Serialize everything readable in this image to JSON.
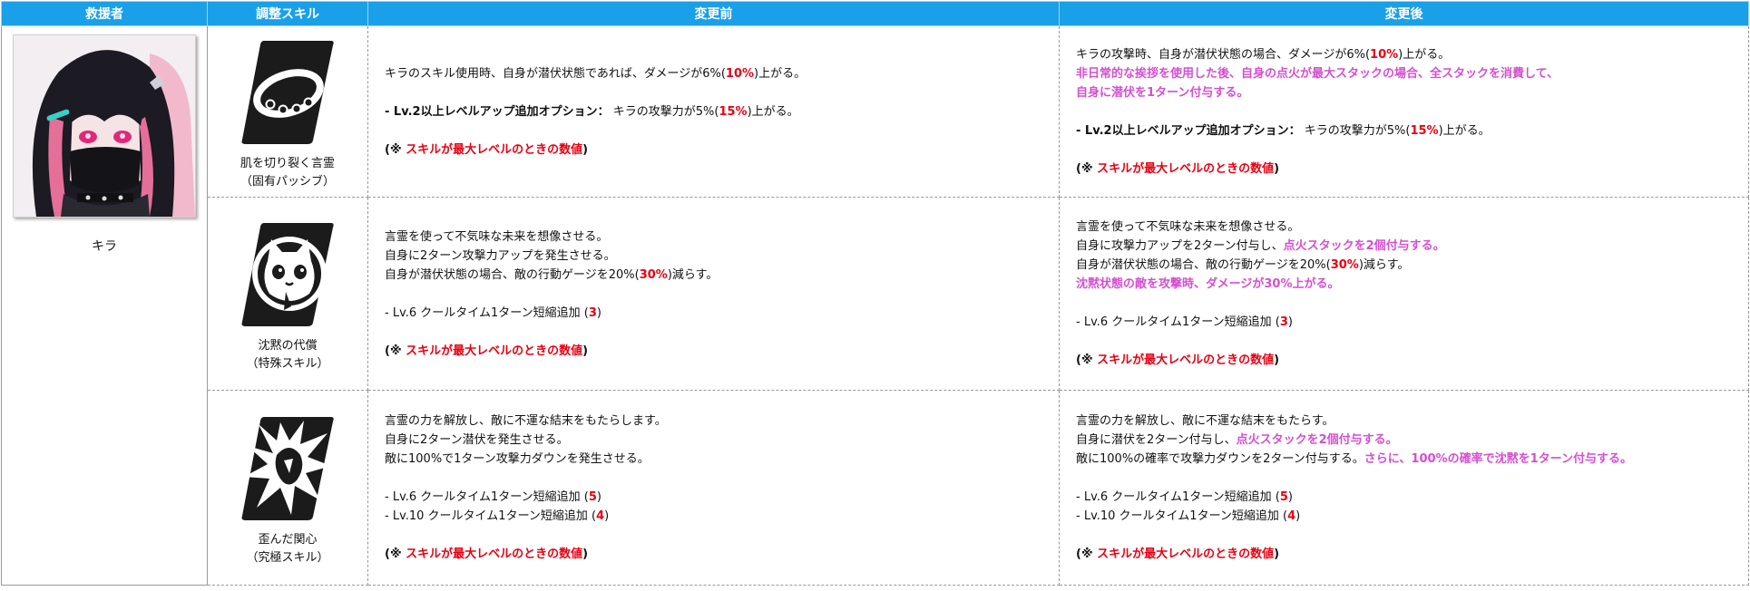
{
  "header": {
    "col_character": "救援者",
    "col_skill": "調整スキル",
    "col_before": "変更前",
    "col_after": "変更後"
  },
  "character": {
    "name": "キラ"
  },
  "rows": [
    {
      "skill_icon": "choker-icon",
      "skill_name": "肌を切り裂く言霊",
      "skill_type": "（固有パッシブ）",
      "before": {
        "l1a": "キラのスキル使用時、自身が潜伏状態であれば、ダメージが6%(",
        "l1r": "10%",
        "l1b": ")上がる。",
        "opt_label": "- Lv.2以上レベルアップ追加オプション：",
        "opt_text": " キラの攻撃力が5%(",
        "opt_red": "15%",
        "opt_end": ")上がる。",
        "note_open": "(※ ",
        "note_text": "スキルが最大レベルのときの数値",
        "note_close": ")"
      },
      "after": {
        "l1a": "キラの攻撃時、自身が潜伏状態の場合、ダメージが6%(",
        "l1r": "10%",
        "l1b": ")上がる。",
        "l2": "非日常的な挨拶を使用した後、自身の点火が最大スタックの場合、全スタックを消費して、",
        "l3": "自身に潜伏を1ターン付与する。",
        "opt_label": "- Lv.2以上レベルアップ追加オプション：",
        "opt_text": " キラの攻撃力が5%(",
        "opt_red": "15%",
        "opt_end": ")上がる。",
        "note_open": "(※ ",
        "note_text": "スキルが最大レベルのときの数値",
        "note_close": ")"
      }
    },
    {
      "skill_icon": "panda-cat-icon",
      "skill_name": "沈黙の代償",
      "skill_type": "（特殊スキル）",
      "before": {
        "l1": "言霊を使って不気味な未来を想像させる。",
        "l2": "自身に2ターン攻撃力アップを発生させる。",
        "l3a": "自身が潜伏状態の場合、敵の行動ゲージを20%(",
        "l3r": "30%",
        "l3b": ")減らす。",
        "cd1a": "- Lv.6 クールタイム1ターン短縮追加 (",
        "cd1r": "3",
        "cd1b": ")",
        "note_open": "(※ ",
        "note_text": "スキルが最大レベルのときの数値",
        "note_close": ")"
      },
      "after": {
        "l1": "言霊を使って不気味な未来を想像させる。",
        "l2a": "自身に攻撃力アップを2ターン付与し、",
        "l2p": "点火スタックを2個付与する。",
        "l3a": "自身が潜伏状態の場合、敵の行動ゲージを20%(",
        "l3r": "30%",
        "l3b": ")減らす。",
        "l4": "沈黙状態の敵を攻撃時、ダメージが30%上がる。",
        "cd1a": "- Lv.6 クールタイム1ターン短縮追加 (",
        "cd1r": "3",
        "cd1b": ")",
        "note_open": "(※ ",
        "note_text": "スキルが最大レベルのときの数値",
        "note_close": ")"
      }
    },
    {
      "skill_icon": "shatter-burst-icon",
      "skill_name": "歪んだ関心",
      "skill_type": "（究極スキル）",
      "before": {
        "l1": "言霊の力を解放し、敵に不運な結末をもたらします。",
        "l2": "自身に2ターン潜伏を発生させる。",
        "l3": "敵に100%で1ターン攻撃力ダウンを発生させる。",
        "cd1a": "- Lv.6 クールタイム1ターン短縮追加 (",
        "cd1r": "5",
        "cd1b": ")",
        "cd2a": "- Lv.10 クールタイム1ターン短縮追加 (",
        "cd2r": "4",
        "cd2b": ")",
        "note_open": "(※ ",
        "note_text": "スキルが最大レベルのときの数値",
        "note_close": ")"
      },
      "after": {
        "l1": "言霊の力を解放し、敵に不運な結末をもたらす。",
        "l2a": "自身に潜伏を2ターン付与し、",
        "l2p": "点火スタックを2個付与する。",
        "l3a": "敵に100%の確率で攻撃力ダウンを2ターン付与する。",
        "l3p": "さらに、100%の確率で沈黙を1ターン付与する。",
        "cd1a": "- Lv.6 クールタイム1ターン短縮追加 (",
        "cd1r": "5",
        "cd1b": ")",
        "cd2a": "- Lv.10 クールタイム1ターン短縮追加 (",
        "cd2r": "4",
        "cd2b": ")",
        "note_open": "(※ ",
        "note_text": "スキルが最大レベルのときの数値",
        "note_close": ")"
      }
    }
  ],
  "colors": {
    "header_bg": "#1aa0e8",
    "highlight_red": "#e60012",
    "highlight_pink": "#d44fd0"
  }
}
